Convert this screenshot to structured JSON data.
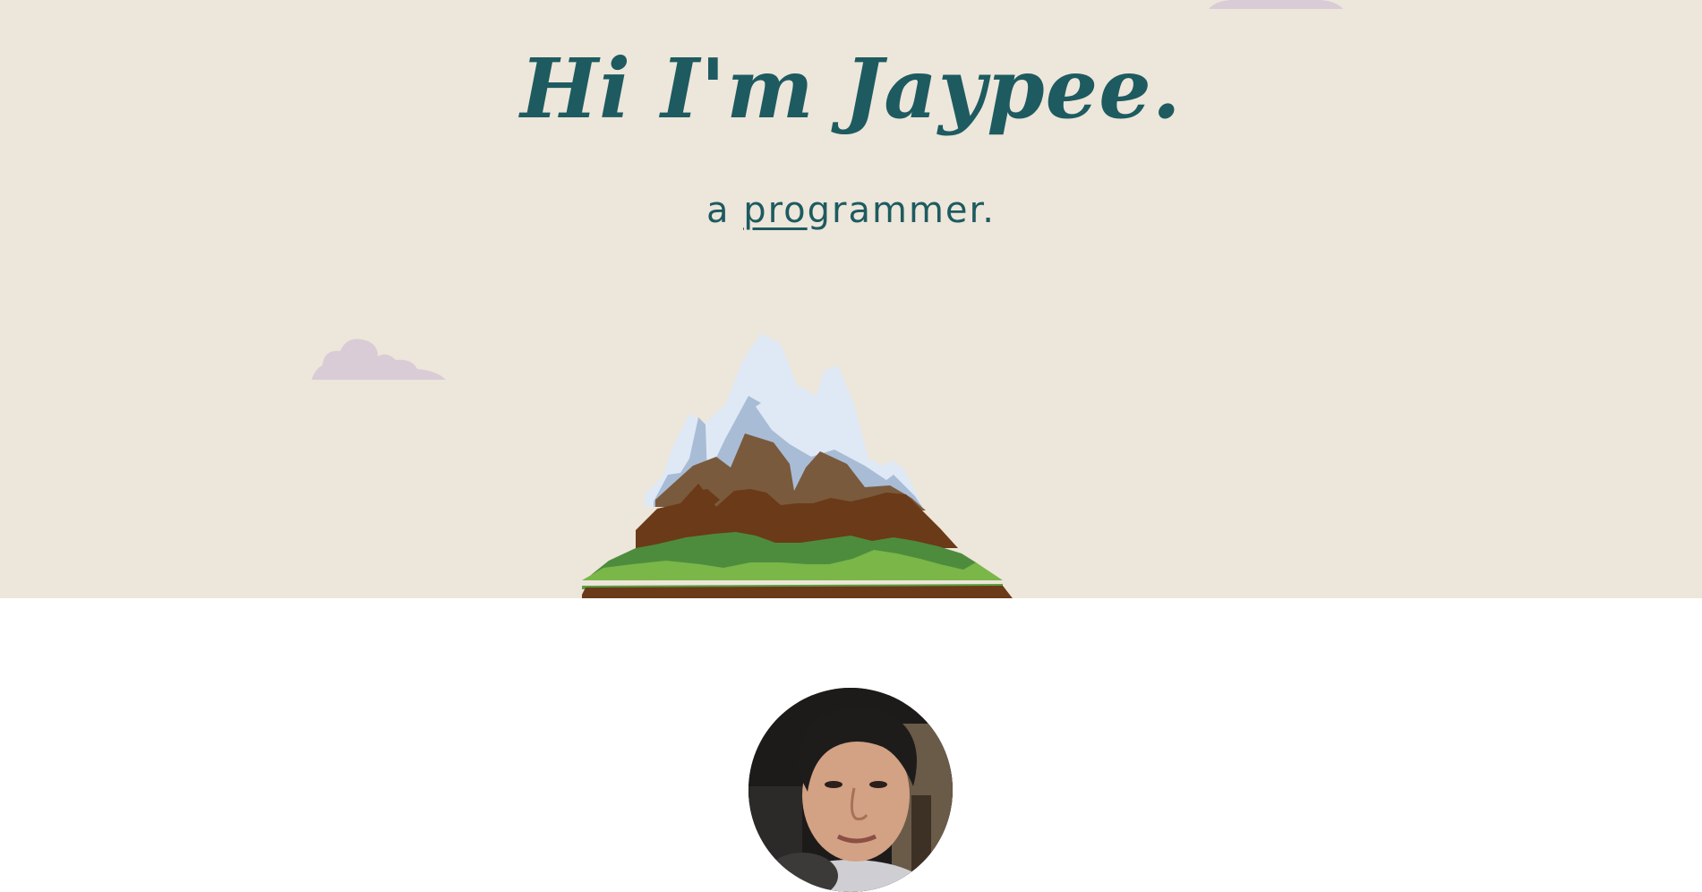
{
  "header": {
    "greeting": "Hi I'm Jaypee.",
    "subtitle_prefix": "a ",
    "subtitle_underlined": "pro",
    "subtitle_suffix": "grammer."
  },
  "colors": {
    "hero_background": "#ede6da",
    "text": "#1d5b60",
    "cloud": "#d9ccd6",
    "page_background": "#ffffff"
  },
  "icons": {
    "cloud_top": "cloud-icon",
    "cloud_left": "cloud-icon",
    "mountain": "mountain-illustration",
    "profile": "profile-photo"
  }
}
